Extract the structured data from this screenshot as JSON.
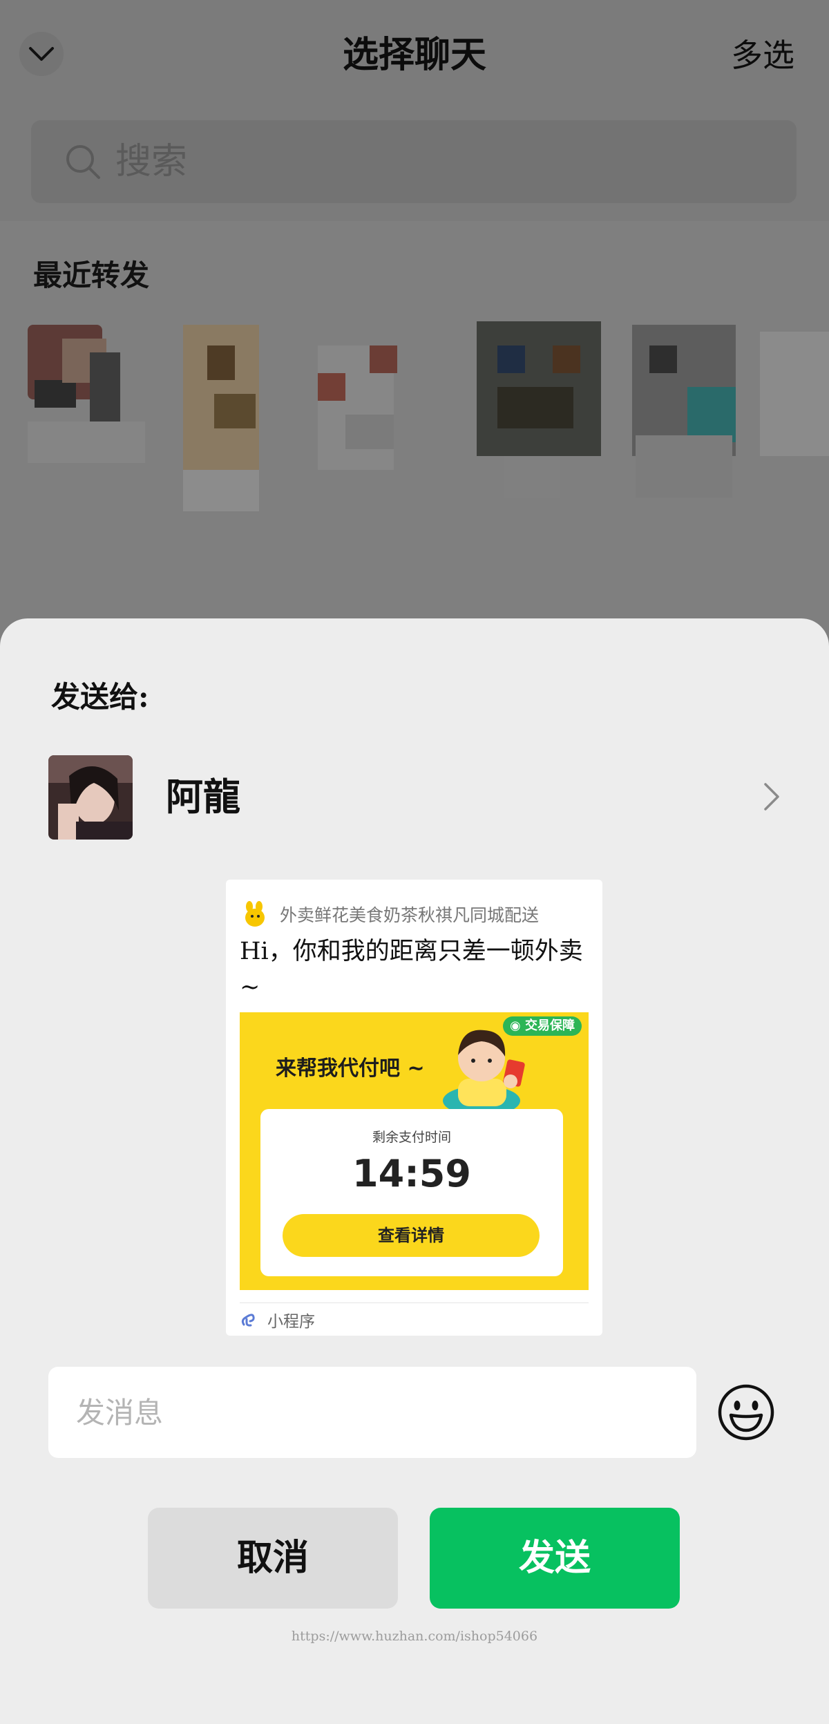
{
  "header": {
    "title": "选择聊天",
    "multi_select_label": "多选"
  },
  "search": {
    "placeholder": "搜索"
  },
  "recent": {
    "label": "最近转发"
  },
  "sheet": {
    "send_to_label": "发送给:",
    "recipient": {
      "name": "阿龍"
    },
    "card": {
      "app_name": "外卖鲜花美食奶茶秋祺凡同城配送",
      "text": "Hi，你和我的距离只差一顿外卖~",
      "promo": {
        "badge": "交易保障",
        "headline": "来帮我代付吧 ~",
        "remaining_label": "剩余支付时间",
        "timer": "14:59",
        "button_label": "查看详情"
      },
      "footer_label": "小程序"
    },
    "message_input": {
      "placeholder": "发消息",
      "value": ""
    },
    "cancel_label": "取消",
    "send_label": "发送"
  },
  "watermark": "https://www.huzhan.com/ishop54066",
  "colors": {
    "accent_green": "#07c160",
    "promo_yellow": "#fbd71c",
    "sheet_bg": "#ededed",
    "overlay_bg": "#7f7f7f"
  },
  "icons": [
    "chevron-down-icon",
    "search-icon",
    "chevron-right-icon",
    "app-logo-icon",
    "mini-program-icon",
    "emoji-icon",
    "shield-icon"
  ]
}
